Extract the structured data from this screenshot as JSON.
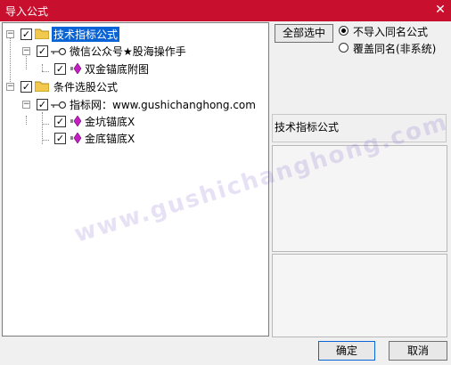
{
  "window": {
    "title": "导入公式",
    "close_glyph": "✕"
  },
  "tree": {
    "nodes": [
      {
        "label": "技术指标公式",
        "checked": true,
        "type": "folder",
        "expanded": true
      },
      {
        "label": "微信公众号★股海操作手",
        "checked": true,
        "type": "key",
        "expanded": true
      },
      {
        "label": "双金锚底附图",
        "checked": true,
        "type": "formula"
      },
      {
        "label": "条件选股公式",
        "checked": true,
        "type": "folder",
        "expanded": true
      },
      {
        "label": "指标网：www.gushichanghong.com",
        "checked": true,
        "type": "key",
        "expanded": true
      },
      {
        "label": "金坑锚底X",
        "checked": true,
        "type": "formula"
      },
      {
        "label": "金底锚底X",
        "checked": true,
        "type": "formula"
      }
    ],
    "check_glyph": "✓",
    "expander_glyph": "−"
  },
  "options": {
    "select_all_label": "全部选中",
    "radio_1_label": "不导入同名公式",
    "radio_2_label": "覆盖同名(非系统)",
    "radio_selected": 1
  },
  "info": {
    "type_label": "技术指标公式"
  },
  "footer": {
    "ok_label": "确定",
    "cancel_label": "取消"
  },
  "watermark": "www.gushichanghong.com",
  "colors": {
    "titlebar": "#c8102e",
    "selection": "#0a64d6",
    "folder": "#f2c94c",
    "formula": "#c020c0"
  }
}
